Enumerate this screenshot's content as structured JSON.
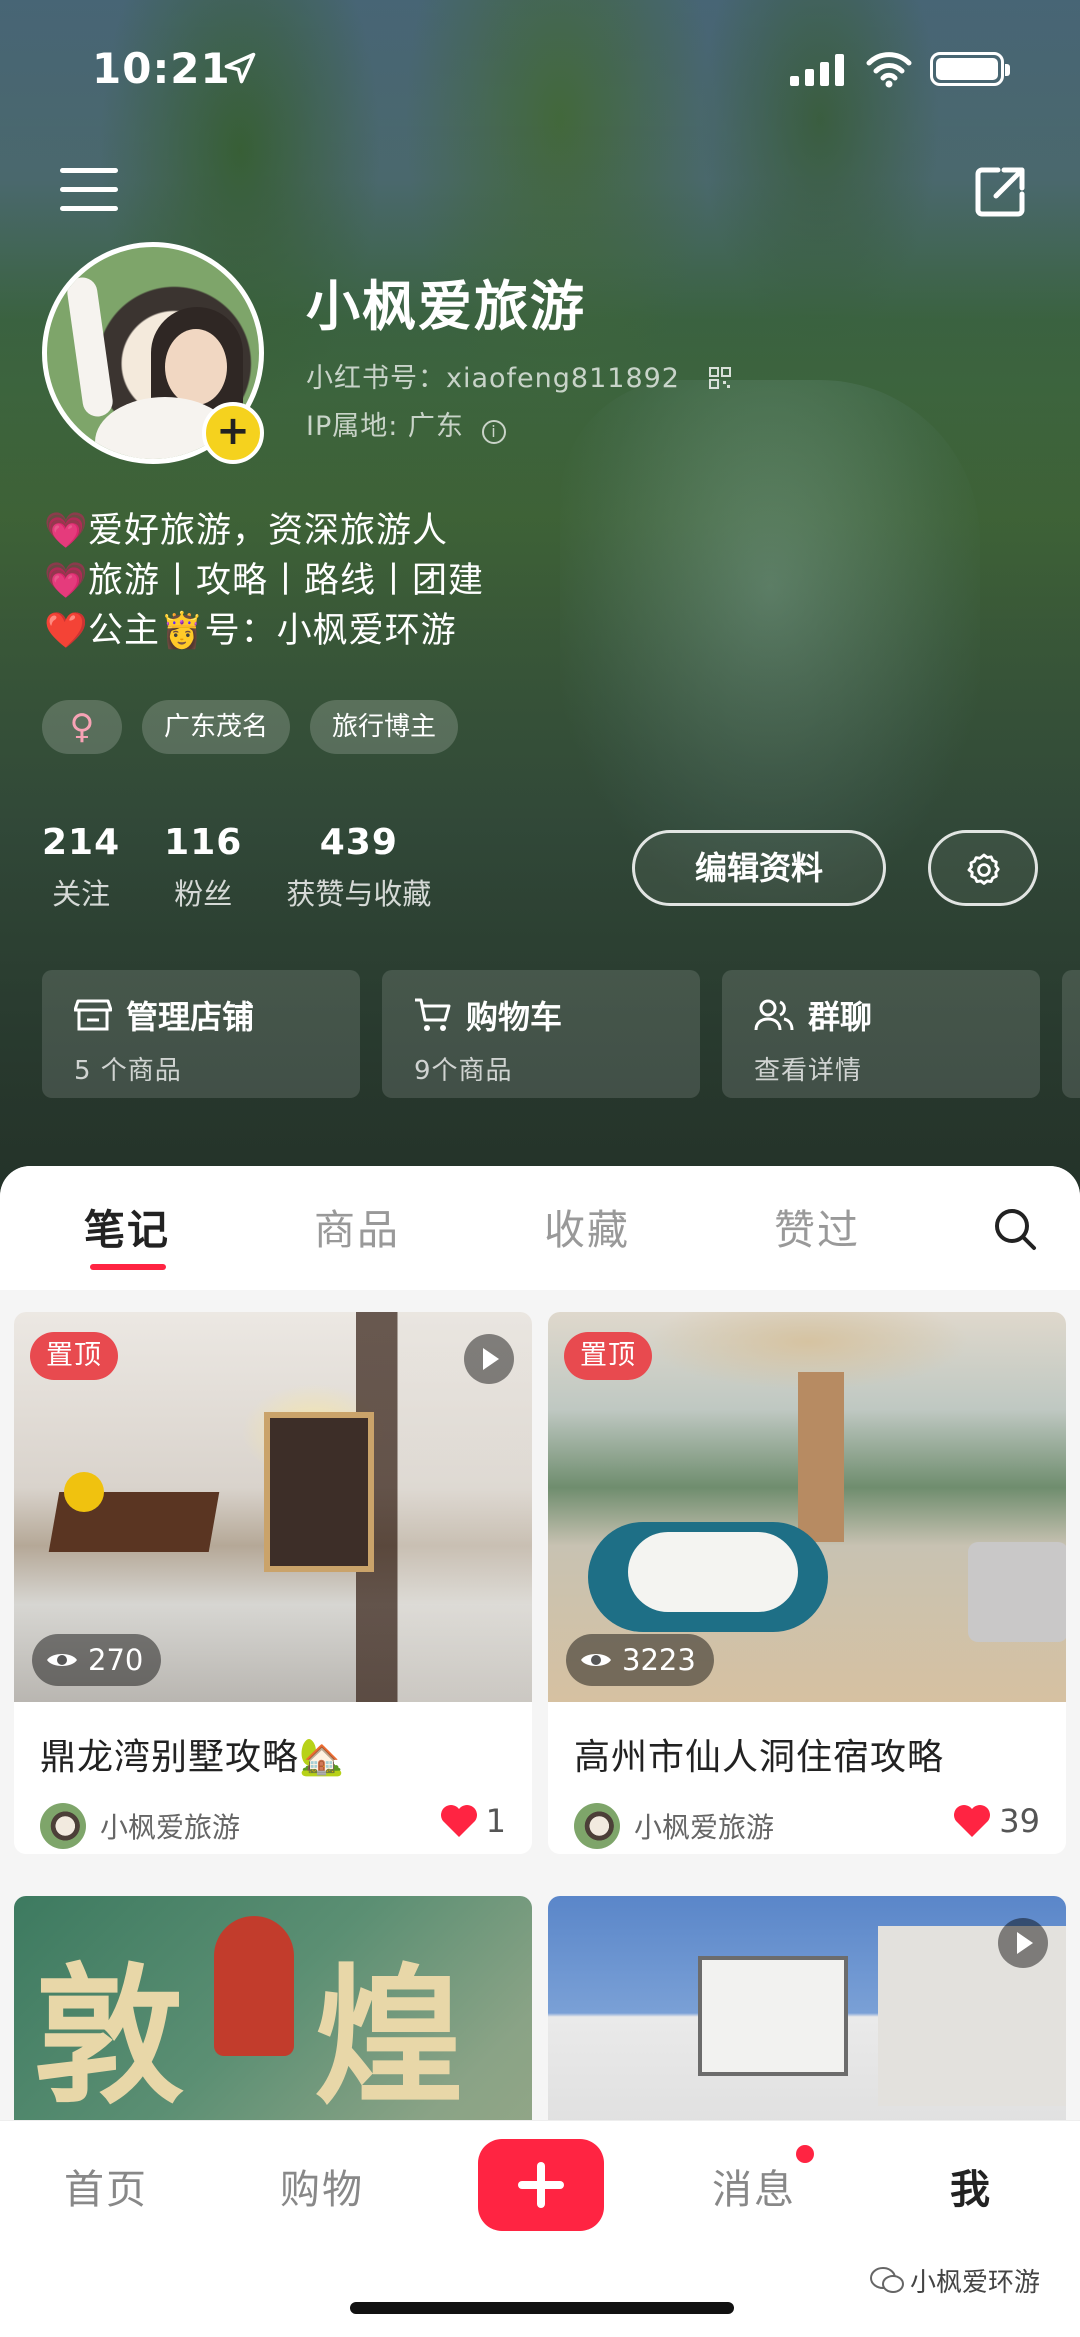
{
  "status_bar": {
    "time": "10:21"
  },
  "profile": {
    "name": "小枫爱旅游",
    "red_id": "小红书号：xiaofeng811892",
    "ip": "IP属地: 广东",
    "bio": [
      {
        "emoji": "💗",
        "text": "爱好旅游，资深旅游人"
      },
      {
        "emoji": "💗",
        "text": "旅游丨攻略丨路线丨团建"
      },
      {
        "emoji": "❤️",
        "text": "公主👸号：小枫爱环游"
      }
    ],
    "tags": {
      "gender": "♀",
      "location": "广东茂名",
      "role": "旅行博主"
    },
    "stats": [
      {
        "num": "214",
        "label": "关注"
      },
      {
        "num": "116",
        "label": "粉丝"
      },
      {
        "num": "439",
        "label": "获赞与收藏"
      }
    ],
    "edit_label": "编辑资料"
  },
  "cards": [
    {
      "title": "管理店铺",
      "sub": "5 个商品",
      "icon": "store-icon"
    },
    {
      "title": "购物车",
      "sub": "9个商品",
      "icon": "cart-icon"
    },
    {
      "title": "群聊",
      "sub": "查看详情",
      "icon": "group-icon"
    }
  ],
  "tabs": [
    "笔记",
    "商品",
    "收藏",
    "赞过"
  ],
  "active_tab": "笔记",
  "notes": [
    {
      "pin": "置顶",
      "views": "270",
      "title": "鼎龙湾别墅攻略🏡",
      "author": "小枫爱旅游",
      "likes": "1"
    },
    {
      "pin": "置顶",
      "views": "3223",
      "title": "高州市仙人洞住宿攻略",
      "author": "小枫爱旅游",
      "likes": "39"
    },
    {
      "chars": [
        "敦",
        "煌"
      ]
    },
    {}
  ],
  "nav": [
    "首页",
    "购物",
    "消息",
    "我"
  ],
  "watermark": "小枫爱环游",
  "colors": {
    "accent": "#ff2442",
    "pin": "#e84a4f",
    "badge": "#f5d21e"
  }
}
